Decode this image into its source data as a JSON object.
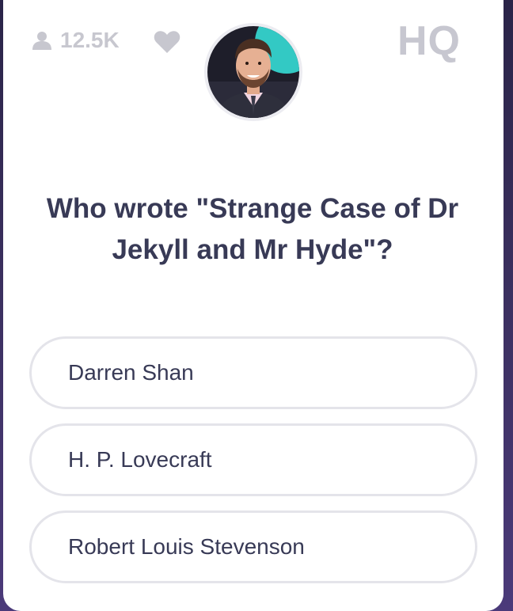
{
  "stats": {
    "viewer_count": "12.5K",
    "user_icon": "user-icon",
    "heart_icon": "heart-icon"
  },
  "brand": {
    "logo_text": "HQ"
  },
  "question": {
    "text": "Who wrote \"Strange Case of Dr Jekyll and Mr Hyde\"?"
  },
  "answers": [
    {
      "label": "Darren Shan"
    },
    {
      "label": "H. P. Lovecraft"
    },
    {
      "label": "Robert Louis Stevenson"
    }
  ],
  "colors": {
    "accent_teal": "#33c9c4",
    "text_dark": "#383a56",
    "muted_gray": "#c7c7cf"
  }
}
